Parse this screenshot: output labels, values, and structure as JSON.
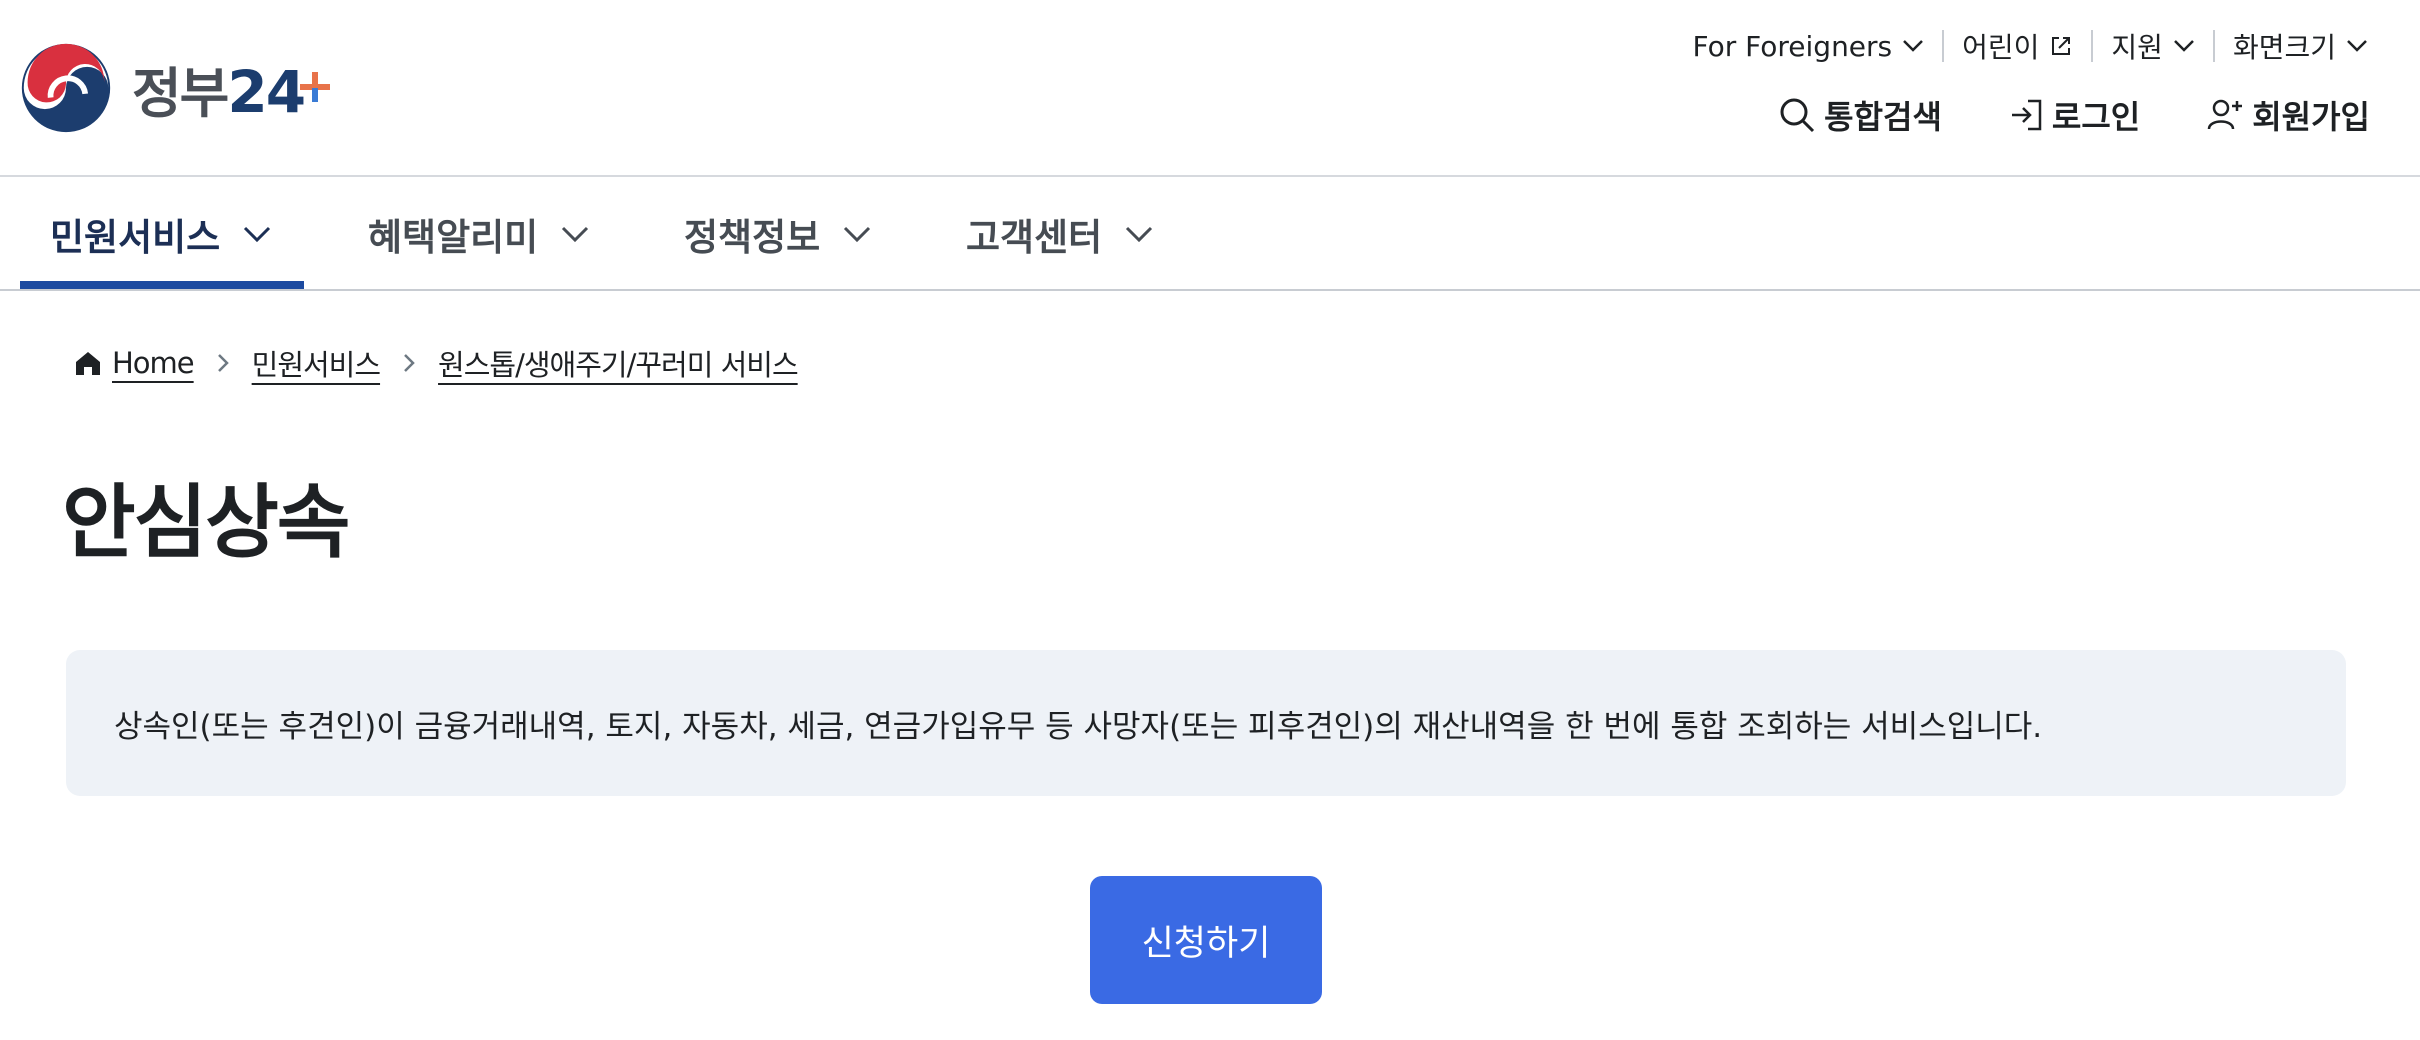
{
  "brand": {
    "name": "정부",
    "num": "24"
  },
  "utility": [
    {
      "label": "For Foreigners",
      "icon": "chevron-down-icon"
    },
    {
      "label": "어린이",
      "icon": "external-link-icon"
    },
    {
      "label": "지원",
      "icon": "chevron-down-icon"
    },
    {
      "label": "화면크기",
      "icon": "chevron-down-icon"
    }
  ],
  "tools": {
    "search": "통합검색",
    "login": "로그인",
    "signup": "회원가입"
  },
  "nav": [
    "민원서비스",
    "혜택알리미",
    "정책정보",
    "고객센터"
  ],
  "breadcrumb": [
    "Home",
    "민원서비스",
    "원스톱/생애주기/꾸러미 서비스"
  ],
  "page": {
    "title": "안심상속",
    "description": "상속인(또는 후견인)이 금융거래내역, 토지, 자동차, 세금, 연금가입유무 등 사망자(또는 피후견인)의 재산내역을 한 번에 통합 조회하는 서비스입니다.",
    "apply_label": "신청하기"
  },
  "colors": {
    "primary": "#3a6ae4",
    "nav_active": "#1c4aa0",
    "info_bg": "#eef2f7"
  }
}
